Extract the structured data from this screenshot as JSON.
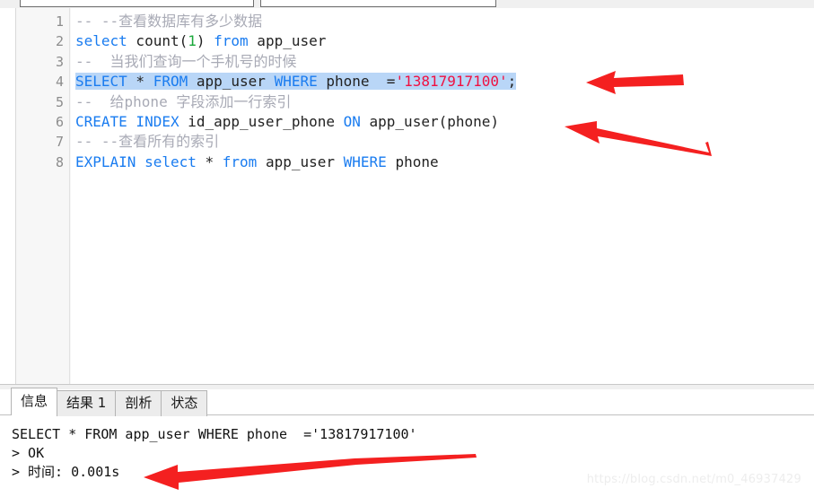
{
  "toolbar": {
    "combo_left_value": "",
    "combo_right_value": ""
  },
  "editor": {
    "lines": [
      {
        "number": "1",
        "selected": false,
        "tokens": [
          {
            "t": "-- --查看数据库有多少数据",
            "c": "cmt"
          }
        ]
      },
      {
        "number": "2",
        "selected": false,
        "tokens": [
          {
            "t": "select",
            "c": "kw"
          },
          {
            "t": " count(",
            "c": ""
          },
          {
            "t": "1",
            "c": "num"
          },
          {
            "t": ") ",
            "c": ""
          },
          {
            "t": "from",
            "c": "kw"
          },
          {
            "t": " app_user",
            "c": ""
          }
        ]
      },
      {
        "number": "3",
        "selected": false,
        "tokens": [
          {
            "t": "--  当我们查询一个手机号的时候",
            "c": "cmt"
          }
        ]
      },
      {
        "number": "4",
        "selected": true,
        "tokens": [
          {
            "t": "SELECT",
            "c": "kw"
          },
          {
            "t": " * ",
            "c": ""
          },
          {
            "t": "FROM",
            "c": "kw"
          },
          {
            "t": " app_user ",
            "c": ""
          },
          {
            "t": "WHERE",
            "c": "kw"
          },
          {
            "t": " phone  =",
            "c": ""
          },
          {
            "t": "'13817917100'",
            "c": "str"
          },
          {
            "t": ";",
            "c": ""
          }
        ]
      },
      {
        "number": "5",
        "selected": false,
        "tokens": [
          {
            "t": "--  给phone 字段添加一行索引",
            "c": "cmt"
          }
        ]
      },
      {
        "number": "6",
        "selected": false,
        "tokens": [
          {
            "t": "CREATE INDEX",
            "c": "kw"
          },
          {
            "t": " id_app_user_phone ",
            "c": ""
          },
          {
            "t": "ON",
            "c": "kw"
          },
          {
            "t": " app_user(phone)",
            "c": ""
          }
        ]
      },
      {
        "number": "7",
        "selected": false,
        "tokens": [
          {
            "t": "-- --查看所有的索引",
            "c": "cmt"
          }
        ]
      },
      {
        "number": "8",
        "selected": false,
        "tokens": [
          {
            "t": "EXPLAIN",
            "c": "kw"
          },
          {
            "t": " ",
            "c": ""
          },
          {
            "t": "select",
            "c": "kw"
          },
          {
            "t": " * ",
            "c": ""
          },
          {
            "t": "from",
            "c": "kw"
          },
          {
            "t": " app_user ",
            "c": ""
          },
          {
            "t": "WHERE",
            "c": "kw"
          },
          {
            "t": " phone",
            "c": ""
          }
        ]
      }
    ]
  },
  "bottom": {
    "tabs": [
      {
        "label": "信息",
        "active": true
      },
      {
        "label": "结果 1",
        "active": false
      },
      {
        "label": "剖析",
        "active": false
      },
      {
        "label": "状态",
        "active": false
      }
    ],
    "console_lines": [
      "SELECT * FROM app_user WHERE phone  ='13817917100'",
      "> OK",
      "> 时间: 0.001s"
    ]
  },
  "annotations": {
    "arrow_color": "#f42020",
    "items": [
      {
        "name": "arrow-to-select-statement"
      },
      {
        "name": "arrow-to-create-index-statement"
      },
      {
        "name": "arrow-to-execution-time"
      }
    ]
  },
  "watermark": {
    "text": "https://blog.csdn.net/m0_46937429"
  }
}
